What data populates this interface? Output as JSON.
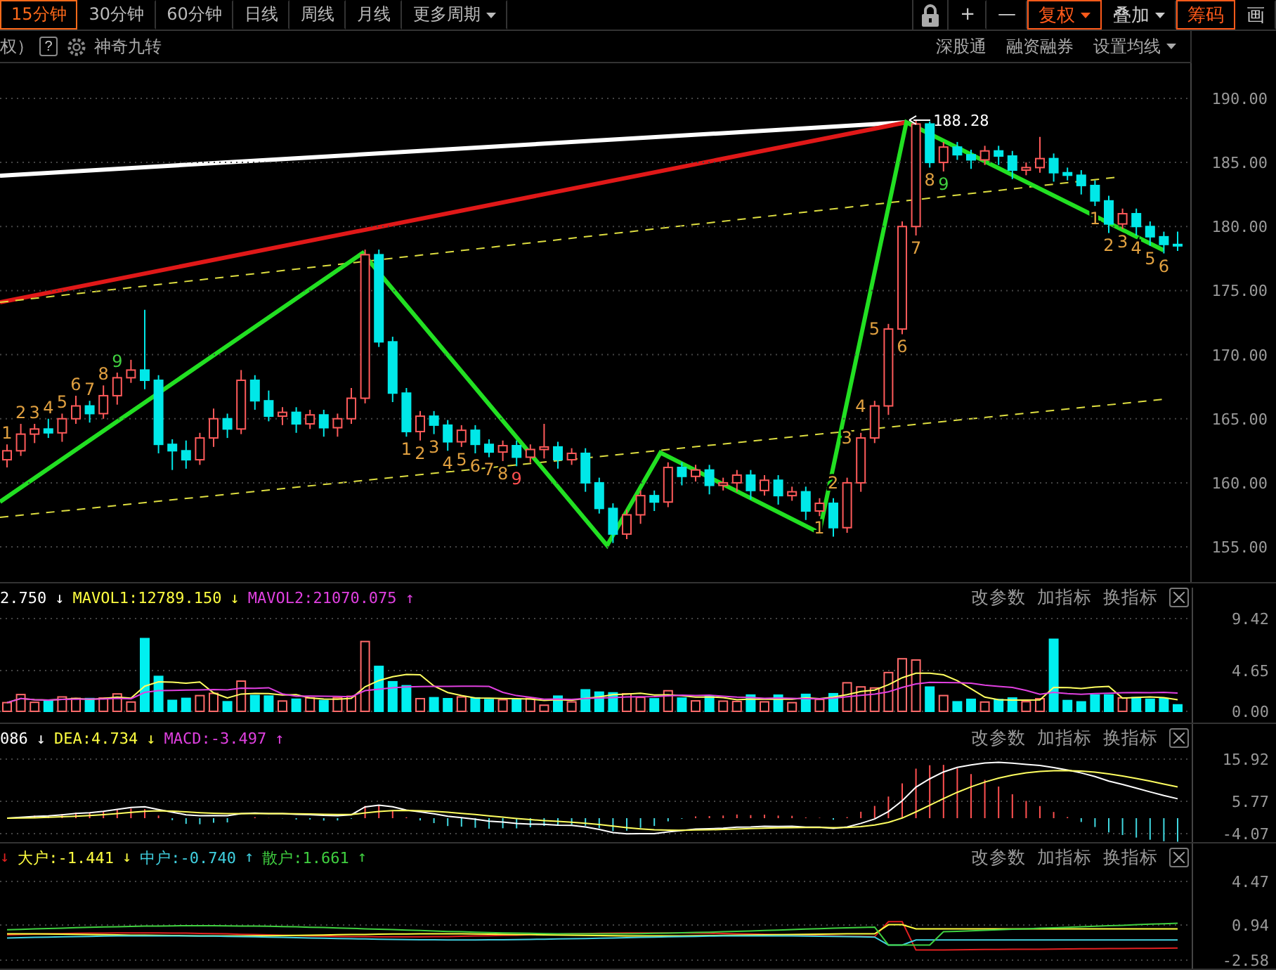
{
  "period_tabs": [
    {
      "label": "15分钟",
      "selected": true,
      "dropdown": false
    },
    {
      "label": "30分钟",
      "selected": false,
      "dropdown": false
    },
    {
      "label": "60分钟",
      "selected": false,
      "dropdown": false
    },
    {
      "label": "日线",
      "selected": false,
      "dropdown": false
    },
    {
      "label": "周线",
      "selected": false,
      "dropdown": false
    },
    {
      "label": "月线",
      "selected": false,
      "dropdown": false
    },
    {
      "label": "更多周期",
      "selected": false,
      "dropdown": true
    }
  ],
  "toolbar": [
    {
      "label": "+",
      "active": false,
      "dropdown": false
    },
    {
      "label": "—",
      "active": false,
      "dropdown": false
    },
    {
      "label": "复权",
      "active": true,
      "dropdown": true
    },
    {
      "label": "叠加",
      "active": false,
      "dropdown": true
    },
    {
      "label": "筹码",
      "active": true,
      "dropdown": false
    },
    {
      "label": "画",
      "active": false,
      "dropdown": false
    }
  ],
  "info_bar": {
    "left_text": "权）",
    "help": "?",
    "indicator_name": "神奇九转",
    "links": [
      {
        "label": "深股通",
        "dropdown": false
      },
      {
        "label": "融资融券",
        "dropdown": false
      },
      {
        "label": "设置均线",
        "dropdown": true
      }
    ]
  },
  "price_chart": {
    "chart_data": {
      "type": "candlestick",
      "grid": true,
      "ylim": [
        152.26,
        192.74
      ],
      "yticks": [
        {
          "value": 190,
          "label": "190.00"
        },
        {
          "value": 185,
          "label": "185.00"
        },
        {
          "value": 180,
          "label": "180.00"
        },
        {
          "value": 175,
          "label": "175.00"
        },
        {
          "value": 170,
          "label": "170.00"
        },
        {
          "value": 165,
          "label": "165.00"
        },
        {
          "value": 160,
          "label": "160.00"
        },
        {
          "value": 155,
          "label": "155.00"
        }
      ],
      "ohlc": [
        [
          161.8,
          163.0,
          161.2,
          162.5
        ],
        [
          162.5,
          164.6,
          162.1,
          163.8
        ],
        [
          163.8,
          164.6,
          163.1,
          164.2
        ],
        [
          164.2,
          165.0,
          163.5,
          163.9
        ],
        [
          163.9,
          165.4,
          163.2,
          165.0
        ],
        [
          165.0,
          166.8,
          164.6,
          166.0
        ],
        [
          166.0,
          166.4,
          164.7,
          165.4
        ],
        [
          165.4,
          167.6,
          165.0,
          166.8
        ],
        [
          166.8,
          168.6,
          166.1,
          168.2
        ],
        [
          168.2,
          169.6,
          167.8,
          168.8
        ],
        [
          168.8,
          173.5,
          167.3,
          168.0
        ],
        [
          168.0,
          168.4,
          162.3,
          163.0
        ],
        [
          163.0,
          163.4,
          161.0,
          162.5
        ],
        [
          162.5,
          163.3,
          161.1,
          161.8
        ],
        [
          161.8,
          163.9,
          161.4,
          163.5
        ],
        [
          163.5,
          165.8,
          162.8,
          165.0
        ],
        [
          165.0,
          165.4,
          163.5,
          164.2
        ],
        [
          164.2,
          168.8,
          163.8,
          168.0
        ],
        [
          168.0,
          168.4,
          165.7,
          166.4
        ],
        [
          166.4,
          167.2,
          164.8,
          165.2
        ],
        [
          165.2,
          165.9,
          164.5,
          165.5
        ],
        [
          165.5,
          165.9,
          163.9,
          164.6
        ],
        [
          164.6,
          165.7,
          164.2,
          165.3
        ],
        [
          165.3,
          165.7,
          163.6,
          164.3
        ],
        [
          164.3,
          165.4,
          163.6,
          165.0
        ],
        [
          165.0,
          167.4,
          164.6,
          166.6
        ],
        [
          166.6,
          178.2,
          166.2,
          177.8
        ],
        [
          177.8,
          178.2,
          170.6,
          171.0
        ],
        [
          171.0,
          171.4,
          166.3,
          167.0
        ],
        [
          167.0,
          167.4,
          163.6,
          164.0
        ],
        [
          164.0,
          165.6,
          163.3,
          165.2
        ],
        [
          165.2,
          165.6,
          163.8,
          164.5
        ],
        [
          164.5,
          164.9,
          162.5,
          163.2
        ],
        [
          163.2,
          164.5,
          162.8,
          164.1
        ],
        [
          164.1,
          164.5,
          162.3,
          163.0
        ],
        [
          163.0,
          163.4,
          162.0,
          162.4
        ],
        [
          162.4,
          163.3,
          161.7,
          162.9
        ],
        [
          162.9,
          163.3,
          161.3,
          162.0
        ],
        [
          162.0,
          163.0,
          161.6,
          162.6
        ],
        [
          162.6,
          164.6,
          161.9,
          162.8
        ],
        [
          162.8,
          163.2,
          161.1,
          161.8
        ],
        [
          161.8,
          162.7,
          161.4,
          162.3
        ],
        [
          162.3,
          162.7,
          159.3,
          160.0
        ],
        [
          160.0,
          160.4,
          157.6,
          158.0
        ],
        [
          158.0,
          158.4,
          155.3,
          156.0
        ],
        [
          156.0,
          157.9,
          155.6,
          157.5
        ],
        [
          157.5,
          159.4,
          156.8,
          159.0
        ],
        [
          159.0,
          159.4,
          157.8,
          158.5
        ],
        [
          158.5,
          161.6,
          158.1,
          161.2
        ],
        [
          161.2,
          161.6,
          159.8,
          160.5
        ],
        [
          160.5,
          161.4,
          160.1,
          161.0
        ],
        [
          161.0,
          161.4,
          159.1,
          159.8
        ],
        [
          159.8,
          160.4,
          159.4,
          160.0
        ],
        [
          160.0,
          161.0,
          159.3,
          160.6
        ],
        [
          160.6,
          161.0,
          158.7,
          159.4
        ],
        [
          159.4,
          160.6,
          159.0,
          160.2
        ],
        [
          160.2,
          160.6,
          158.3,
          159.0
        ],
        [
          159.0,
          159.7,
          158.6,
          159.3
        ],
        [
          159.3,
          159.7,
          157.1,
          157.8
        ],
        [
          157.8,
          158.8,
          157.4,
          158.4
        ],
        [
          158.4,
          158.8,
          155.8,
          156.5
        ],
        [
          156.5,
          160.4,
          156.1,
          160.0
        ],
        [
          160.0,
          163.9,
          159.3,
          163.5
        ],
        [
          163.5,
          166.4,
          163.1,
          166.0
        ],
        [
          166.0,
          172.4,
          165.3,
          172.0
        ],
        [
          172.0,
          180.4,
          171.6,
          180.0
        ],
        [
          180.0,
          188.28,
          179.3,
          188.0
        ],
        [
          188.0,
          188.2,
          184.6,
          185.0
        ],
        [
          185.0,
          186.6,
          184.3,
          186.2
        ],
        [
          186.2,
          186.6,
          185.2,
          185.6
        ],
        [
          185.6,
          186.0,
          184.5,
          185.2
        ],
        [
          185.2,
          186.3,
          184.8,
          185.9
        ],
        [
          185.9,
          186.3,
          184.8,
          185.5
        ],
        [
          185.5,
          185.9,
          183.7,
          184.4
        ],
        [
          184.4,
          185.0,
          184.0,
          184.6
        ],
        [
          184.6,
          187.0,
          184.2,
          185.3
        ],
        [
          185.3,
          185.7,
          183.5,
          184.2
        ],
        [
          184.2,
          184.6,
          183.6,
          184.0
        ],
        [
          184.0,
          184.4,
          182.5,
          183.2
        ],
        [
          183.2,
          183.6,
          181.6,
          182.0
        ],
        [
          182.0,
          182.4,
          179.5,
          180.2
        ],
        [
          180.2,
          181.4,
          179.8,
          181.0
        ],
        [
          181.0,
          181.4,
          179.3,
          180.0
        ],
        [
          180.0,
          180.4,
          178.5,
          179.2
        ],
        [
          179.2,
          179.6,
          177.9,
          178.6
        ],
        [
          178.6,
          179.6,
          178.1,
          178.5
        ]
      ]
    },
    "peak_label": "188.28",
    "nine_turn_sequences": [
      {
        "labels": [
          {
            "text": "1",
            "color": "#e0a040"
          },
          {
            "text": "2",
            "color": "#e0a040"
          },
          {
            "text": "3",
            "color": "#e0a040"
          },
          {
            "text": "4",
            "color": "#e0a040"
          },
          {
            "text": "5",
            "color": "#e0a040"
          },
          {
            "text": "6",
            "color": "#e0a040"
          },
          {
            "text": "7",
            "color": "#e0a040"
          },
          {
            "text": "8",
            "color": "#e0a040"
          },
          {
            "text": "9",
            "color": "#40d040"
          }
        ]
      },
      {
        "labels": [
          {
            "text": "1",
            "color": "#e0a040"
          },
          {
            "text": "2",
            "color": "#e0a040"
          },
          {
            "text": "3",
            "color": "#e0a040"
          },
          {
            "text": "4",
            "color": "#e0a040"
          },
          {
            "text": "5",
            "color": "#e0a040"
          },
          {
            "text": "6",
            "color": "#e0a040"
          },
          {
            "text": "7",
            "color": "#e0a040"
          },
          {
            "text": "8",
            "color": "#e0a040"
          },
          {
            "text": "9",
            "color": "#ff5050"
          }
        ]
      },
      {
        "labels": [
          {
            "text": "1",
            "color": "#e0a040"
          },
          {
            "text": "2",
            "color": "#e0a040"
          },
          {
            "text": "3",
            "color": "#e0a040"
          },
          {
            "text": "4",
            "color": "#e0a040"
          },
          {
            "text": "5",
            "color": "#e0a040"
          },
          {
            "text": "6",
            "color": "#e0a040"
          },
          {
            "text": "7",
            "color": "#e0a040"
          },
          {
            "text": "8",
            "color": "#e0a040"
          },
          {
            "text": "9",
            "color": "#40d040"
          }
        ]
      },
      {
        "labels": [
          {
            "text": "1",
            "color": "#e0a040"
          },
          {
            "text": "2",
            "color": "#e0a040"
          },
          {
            "text": "3",
            "color": "#e0a040"
          },
          {
            "text": "4",
            "color": "#e0a040"
          },
          {
            "text": "5",
            "color": "#e0a040"
          },
          {
            "text": "6",
            "color": "#e0a040"
          }
        ]
      }
    ]
  },
  "indicator_panels": [
    {
      "kind": "volume",
      "legend": [
        {
          "text": "2.750",
          "arrow": "↓",
          "color": "#ffffff"
        },
        {
          "text": "MAVOL1:12789.150",
          "arrow": "↓",
          "color": "#ffff40"
        },
        {
          "text": "MAVOL2:21070.075",
          "arrow": "↑",
          "color": "#e040e0"
        }
      ],
      "actions": [
        "改参数",
        "加指标",
        "换指标"
      ],
      "axis_ticks": [
        "9.42",
        "4.65",
        "0.00"
      ]
    },
    {
      "kind": "macd",
      "legend": [
        {
          "text": "086",
          "arrow": "↓",
          "color": "#ffffff"
        },
        {
          "text": "DEA:4.734",
          "arrow": "↓",
          "color": "#ffff40"
        },
        {
          "text": "MACD:-3.497",
          "arrow": "↑",
          "color": "#e040e0"
        }
      ],
      "actions": [
        "改参数",
        "加指标",
        "换指标"
      ],
      "axis_ticks": [
        "15.92",
        "5.77",
        "-4.07"
      ]
    },
    {
      "kind": "flow",
      "legend": [
        {
          "arrow": "↓",
          "color": "#e02020"
        },
        {
          "text": "大户:-1.441",
          "arrow": "↓",
          "color": "#ffff40"
        },
        {
          "text": "中户:-0.740",
          "arrow": "↑",
          "color": "#40d0e0"
        },
        {
          "text": "散户:1.661",
          "arrow": "↑",
          "color": "#40d040"
        }
      ],
      "actions": [
        "改参数",
        "加指标",
        "换指标"
      ],
      "axis_ticks": [
        "4.47",
        "0.94",
        "-2.58"
      ]
    }
  ]
}
